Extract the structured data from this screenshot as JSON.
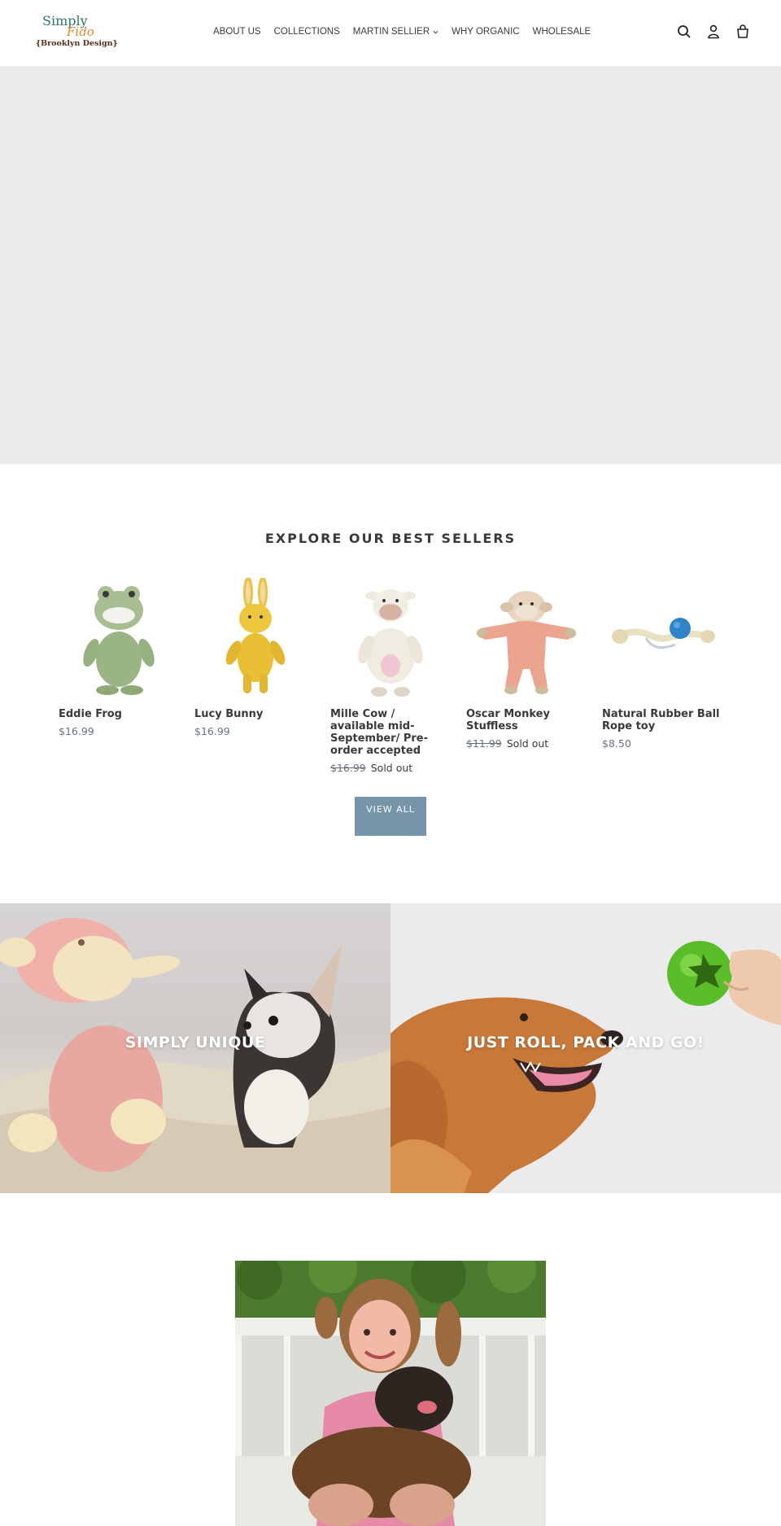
{
  "header": {
    "logo": {
      "line1": "Simply",
      "line2": "Fido",
      "line3": "{Brooklyn Design}"
    },
    "nav": [
      {
        "label": "ABOUT US"
      },
      {
        "label": "COLLECTIONS"
      },
      {
        "label": "MARTIN SELLIER",
        "has_dropdown": true
      },
      {
        "label": "WHY ORGANIC"
      },
      {
        "label": "WHOLESALE"
      }
    ],
    "icons": [
      "search-icon",
      "account-icon",
      "cart-icon"
    ]
  },
  "best_sellers": {
    "title": "EXPLORE OUR BEST SELLERS",
    "products": [
      {
        "name": "Eddie Frog",
        "price": "$16.99"
      },
      {
        "name": "Lucy Bunny",
        "price": "$16.99"
      },
      {
        "name": "Mille Cow / available mid-September/ Pre-order accepted",
        "price": "$16.99",
        "status": "Sold out"
      },
      {
        "name": "Oscar Monkey Stuffless",
        "price": "$11.99",
        "status": "Sold out"
      },
      {
        "name": "Natural Rubber Ball Rope toy",
        "price": "$8.50"
      }
    ],
    "view_all": "VIEW ALL"
  },
  "collections": [
    {
      "label": "SIMPLY UNIQUE"
    },
    {
      "label": "JUST ROLL, PACK AND GO!"
    }
  ],
  "colors": {
    "accent_button": "#7795a8",
    "hero_bg": "#eaeaea",
    "text": "#3a3a3a",
    "price": "#69727b"
  }
}
